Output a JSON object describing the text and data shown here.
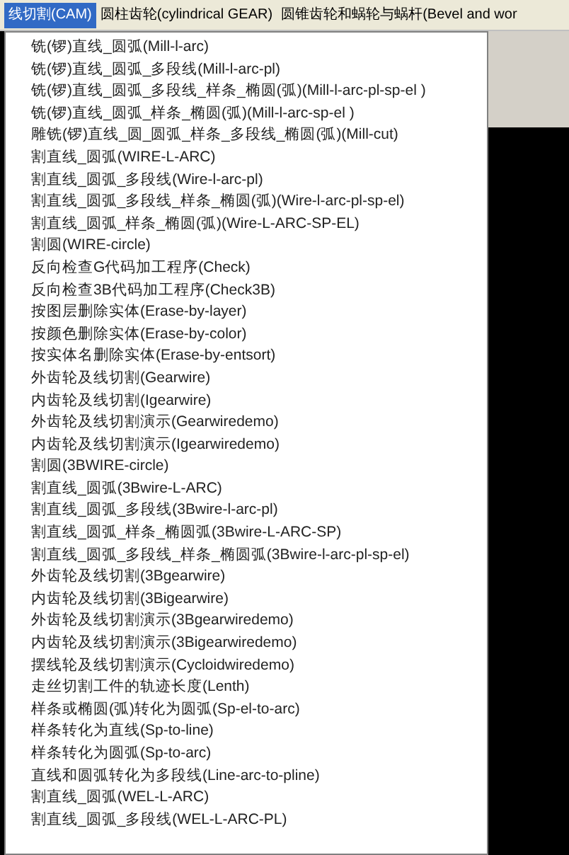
{
  "menu_bar": [
    {
      "label": "线切割(CAM)",
      "selected": true
    },
    {
      "label": "圆柱齿轮(cylindrical GEAR)",
      "selected": false
    },
    {
      "label": "圆锥齿轮和蜗轮与蜗杆(Bevel and wor",
      "selected": false
    }
  ],
  "menu_items": [
    "铣(锣)直线_圆弧(Mill-l-arc)",
    "铣(锣)直线_圆弧_多段线(Mill-l-arc-pl)",
    "铣(锣)直线_圆弧_多段线_样条_椭圆(弧)(Mill-l-arc-pl-sp-el )",
    "铣(锣)直线_圆弧_样条_椭圆(弧)(Mill-l-arc-sp-el )",
    "雕铣(锣)直线_圆_圆弧_样条_多段线_椭圆(弧)(Mill-cut)",
    "割直线_圆弧(WIRE-L-ARC)",
    "割直线_圆弧_多段线(Wire-l-arc-pl)",
    "割直线_圆弧_多段线_样条_椭圆(弧)(Wire-l-arc-pl-sp-el)",
    "割直线_圆弧_样条_椭圆(弧)(Wire-L-ARC-SP-EL)",
    "割圆(WIRE-circle)",
    "反向检查G代码加工程序(Check)",
    "反向检查3B代码加工程序(Check3B)",
    "按图层删除实体(Erase-by-layer)",
    "按颜色删除实体(Erase-by-color)",
    "按实体名删除实体(Erase-by-entsort)",
    "外齿轮及线切割(Gearwire)",
    "内齿轮及线切割(Igearwire)",
    "外齿轮及线切割演示(Gearwiredemo)",
    "内齿轮及线切割演示(Igearwiredemo)",
    "割圆(3BWIRE-circle)",
    "割直线_圆弧(3Bwire-L-ARC)",
    "割直线_圆弧_多段线(3Bwire-l-arc-pl)",
    "割直线_圆弧_样条_椭圆弧(3Bwire-L-ARC-SP)",
    "割直线_圆弧_多段线_样条_椭圆弧(3Bwire-l-arc-pl-sp-el)",
    "外齿轮及线切割(3Bgearwire)",
    "内齿轮及线切割(3Bigearwire)",
    "外齿轮及线切割演示(3Bgearwiredemo)",
    "内齿轮及线切割演示(3Bigearwiredemo)",
    "摆线轮及线切割演示(Cycloidwiredemo)",
    "走丝切割工件的轨迹长度(Lenth)",
    "样条或椭圆(弧)转化为圆弧(Sp-el-to-arc)",
    "样条转化为直线(Sp-to-line)",
    "样条转化为圆弧(Sp-to-arc)",
    "直线和圆弧转化为多段线(Line-arc-to-pline)",
    "割直线_圆弧(WEL-L-ARC)",
    "割直线_圆弧_多段线(WEL-L-ARC-PL)"
  ]
}
